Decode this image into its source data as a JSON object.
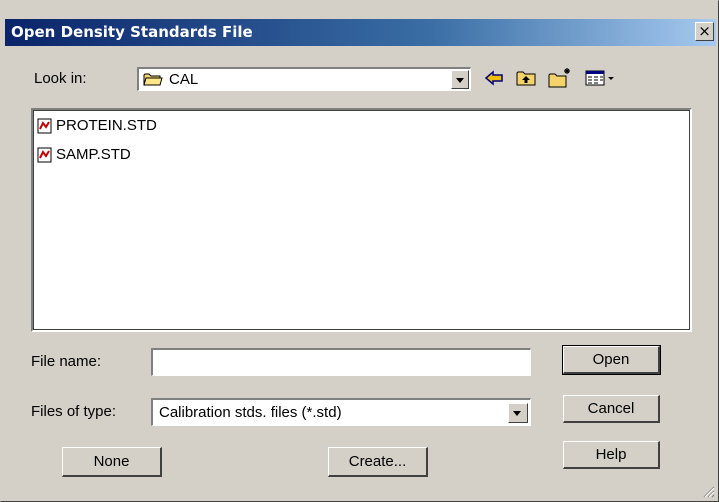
{
  "window": {
    "title": "Open Density Standards File",
    "close_label": "×"
  },
  "look_in": {
    "label": "Look in:",
    "value": "CAL",
    "icon": "folder-icon"
  },
  "toolbar": {
    "icons": [
      "back-arrow-icon",
      "up-folder-icon",
      "new-folder-icon",
      "view-menu-icon"
    ]
  },
  "files": [
    {
      "name": "PROTEIN.STD",
      "icon": "std-file-icon"
    },
    {
      "name": "SAMP.STD",
      "icon": "std-file-icon"
    }
  ],
  "file_name": {
    "label": "File name:",
    "value": ""
  },
  "file_type": {
    "label": "Files of type:",
    "value": "Calibration stds. files (*.std)"
  },
  "buttons": {
    "open": "Open",
    "cancel": "Cancel",
    "help": "Help",
    "none": "None",
    "create": "Create..."
  },
  "colors": {
    "title_gradient_start": "#0a246a",
    "title_gradient_end": "#a6caf0",
    "face": "#d4d0c8",
    "toolbar_arrow": "#f0c000"
  }
}
